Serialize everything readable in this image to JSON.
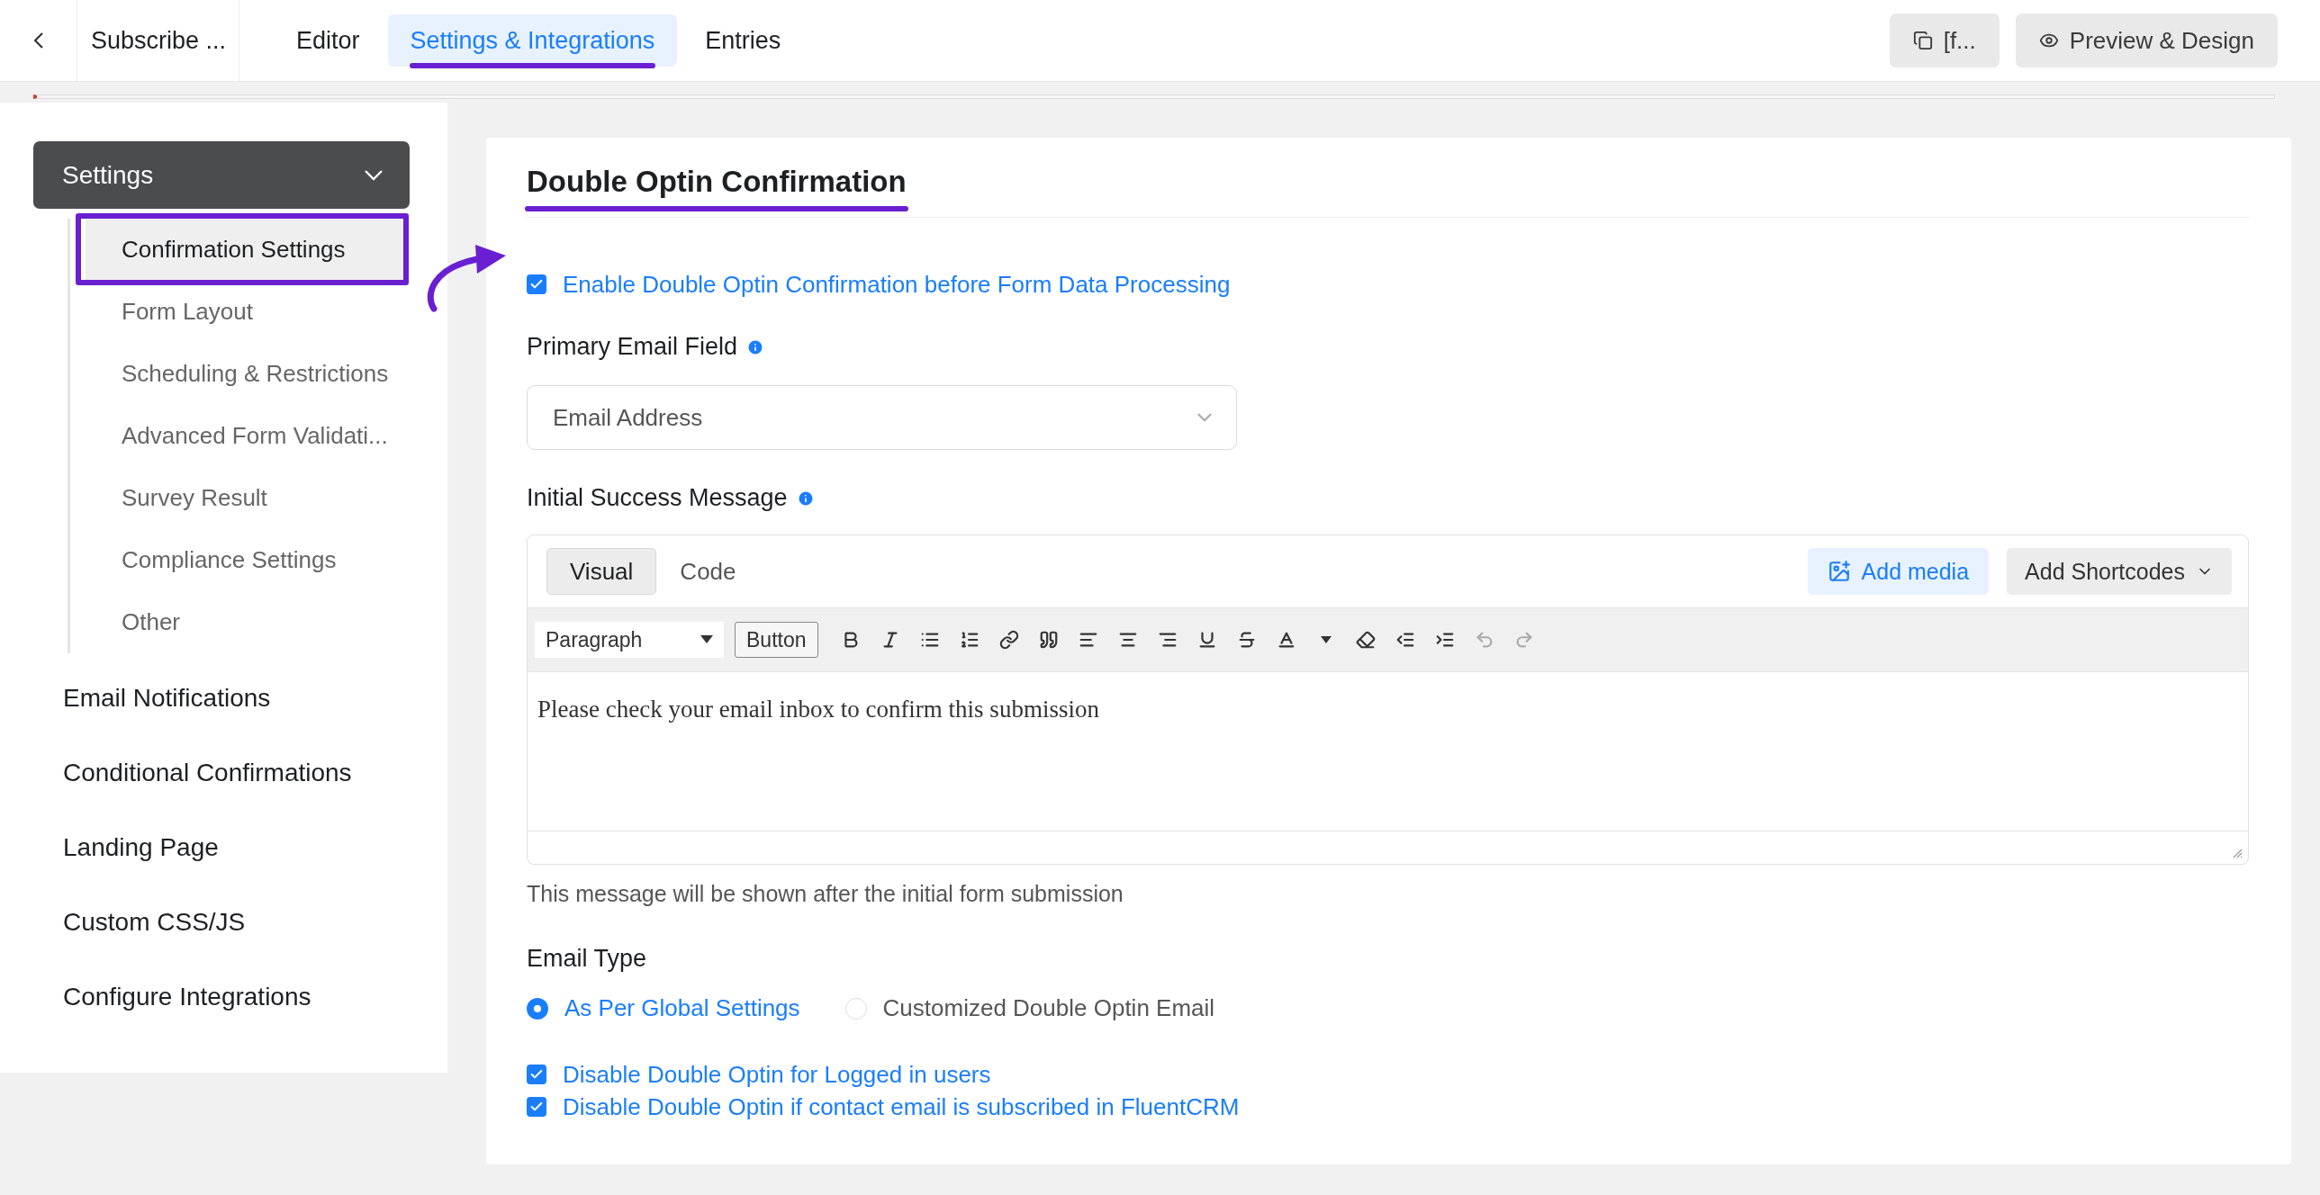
{
  "top_bar": {
    "form_name": "Subscribe ...",
    "tabs": [
      {
        "label": "Editor",
        "selected": false
      },
      {
        "label": "Settings & Integrations",
        "selected": true
      },
      {
        "label": "Entries",
        "selected": false
      }
    ],
    "buttons": [
      {
        "label": "[f...",
        "kind": "copy"
      },
      {
        "label": "Preview & Design",
        "kind": "preview"
      }
    ]
  },
  "sidebar": {
    "group": {
      "label": "Settings",
      "expanded": true,
      "children": [
        {
          "label": "Confirmation Settings",
          "selected": true
        },
        {
          "label": "Form Layout",
          "selected": false
        },
        {
          "label": "Scheduling & Restrictions",
          "selected": false
        },
        {
          "label": "Advanced Form Validati...",
          "selected": false
        },
        {
          "label": "Survey Result",
          "selected": false
        },
        {
          "label": "Compliance Settings",
          "selected": false
        },
        {
          "label": "Other",
          "selected": false
        }
      ]
    },
    "items": [
      "Email Notifications",
      "Conditional Confirmations",
      "Landing Page",
      "Custom CSS/JS",
      "Configure Integrations"
    ]
  },
  "panel": {
    "title": "Double Optin Confirmation",
    "enable": {
      "label": "Enable Double Optin Confirmation before Form Data Processing",
      "checked": true
    },
    "primary_email": {
      "label": "Primary Email Field",
      "value": "Email Address"
    },
    "success_message": {
      "label": "Initial Success Message",
      "editor_tabs": [
        {
          "label": "Visual",
          "selected": true
        },
        {
          "label": "Code",
          "selected": false
        }
      ],
      "add_media": "Add media",
      "add_shortcodes": "Add Shortcodes",
      "format": "Paragraph",
      "button_label": "Button",
      "content": "Please check your email inbox to confirm this submission",
      "help": "This message will be shown after the initial form submission"
    },
    "email_type": {
      "label": "Email Type",
      "options": [
        {
          "label": "As Per Global Settings",
          "selected": true
        },
        {
          "label": "Customized Double Optin Email",
          "selected": false
        }
      ]
    },
    "options": [
      {
        "label": "Disable Double Optin for Logged in users",
        "checked": true
      },
      {
        "label": "Disable Double Optin if contact email is subscribed in FluentCRM",
        "checked": true
      }
    ]
  }
}
